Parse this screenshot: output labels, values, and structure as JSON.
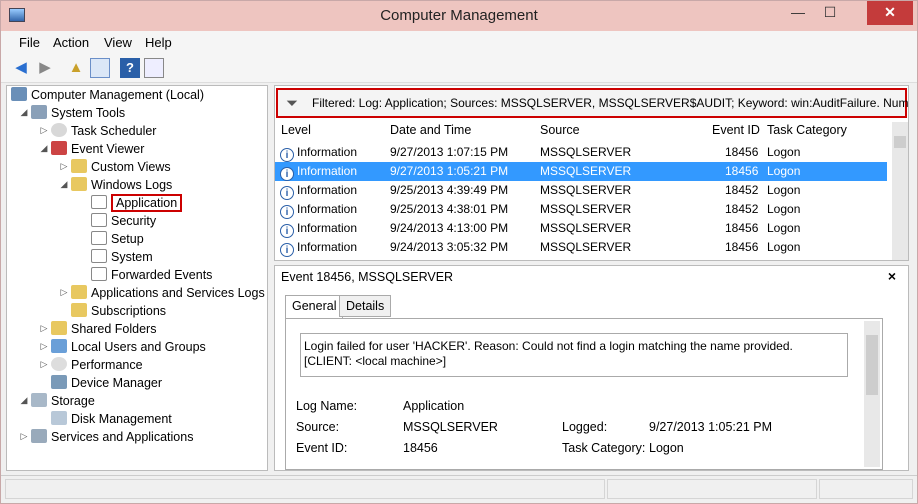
{
  "window": {
    "title": "Computer Management"
  },
  "menu": [
    "File",
    "Action",
    "View",
    "Help"
  ],
  "tree": {
    "root": "Computer Management (Local)",
    "system_tools": "System Tools",
    "task_scheduler": "Task Scheduler",
    "event_viewer": "Event Viewer",
    "custom_views": "Custom Views",
    "windows_logs": "Windows Logs",
    "application": "Application",
    "security": "Security",
    "setup": "Setup",
    "system": "System",
    "forwarded_events": "Forwarded Events",
    "apps_services_logs": "Applications and Services Logs",
    "subscriptions": "Subscriptions",
    "shared_folders": "Shared Folders",
    "local_users": "Local Users and Groups",
    "performance": "Performance",
    "device_manager": "Device Manager",
    "storage": "Storage",
    "disk_management": "Disk Management",
    "services_apps": "Services and Applications"
  },
  "filter": {
    "text": "Filtered: Log: Application; Sources: MSSQLSERVER, MSSQLSERVER$AUDIT; Keyword: win:AuditFailure. Number"
  },
  "columns": {
    "level": "Level",
    "date": "Date and Time",
    "source": "Source",
    "event_id": "Event ID",
    "category": "Task Category"
  },
  "events": [
    {
      "level": "Information",
      "date": "9/27/2013 1:07:15 PM",
      "source": "MSSQLSERVER",
      "event_id": "18456",
      "category": "Logon"
    },
    {
      "level": "Information",
      "date": "9/27/2013 1:05:21 PM",
      "source": "MSSQLSERVER",
      "event_id": "18456",
      "category": "Logon"
    },
    {
      "level": "Information",
      "date": "9/25/2013 4:39:49 PM",
      "source": "MSSQLSERVER",
      "event_id": "18452",
      "category": "Logon"
    },
    {
      "level": "Information",
      "date": "9/25/2013 4:38:01 PM",
      "source": "MSSQLSERVER",
      "event_id": "18452",
      "category": "Logon"
    },
    {
      "level": "Information",
      "date": "9/24/2013 4:13:00 PM",
      "source": "MSSQLSERVER",
      "event_id": "18456",
      "category": "Logon"
    },
    {
      "level": "Information",
      "date": "9/24/2013 3:05:32 PM",
      "source": "MSSQLSERVER",
      "event_id": "18456",
      "category": "Logon"
    }
  ],
  "detail": {
    "title": "Event 18456, MSSQLSERVER",
    "close_glyph": "×",
    "tab_general": "General",
    "tab_details": "Details",
    "message": "Login failed for user 'HACKER'. Reason: Could not find a login matching the name provided. [CLIENT: <local machine>]",
    "log_name_label": "Log Name:",
    "log_name": "Application",
    "source_label": "Source:",
    "source": "MSSQLSERVER",
    "logged_label": "Logged:",
    "logged": "9/27/2013 1:05:21 PM",
    "event_id_label": "Event ID:",
    "event_id": "18456",
    "task_category_label": "Task Category:",
    "task_category": "Logon"
  },
  "window_controls": {
    "minimize": "—",
    "maximize": "☐",
    "close": "✕"
  },
  "colors": {
    "selection": "#3399ff",
    "highlight_border": "#cc0000",
    "titlebar": "#eec5c0"
  }
}
